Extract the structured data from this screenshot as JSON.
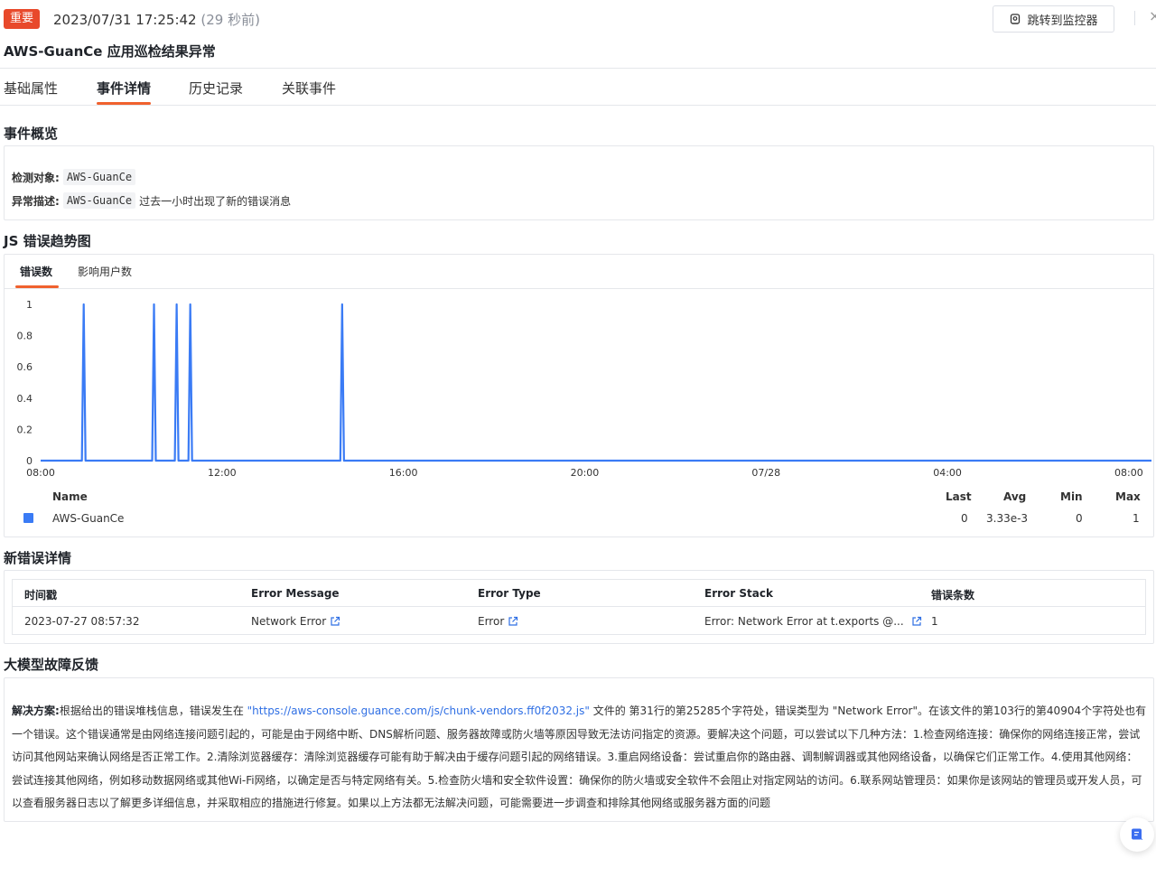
{
  "header": {
    "badge": "重要",
    "timestamp": "2023/07/31 17:25:42",
    "ago": "(29 秒前)",
    "jump_button": "跳转到监控器",
    "close": "×",
    "title": "AWS-GuanCe 应用巡检结果异常"
  },
  "tabs": [
    "基础属性",
    "事件详情",
    "历史记录",
    "关联事件"
  ],
  "overview": {
    "heading": "事件概览",
    "target_label": "检测对象:",
    "target_value": "AWS-GuanCe",
    "desc_label": "异常描述:",
    "desc_code": "AWS-GuanCe",
    "desc_text": "过去一小时出现了新的错误消息"
  },
  "trend": {
    "heading": "JS 错误趋势图",
    "tabs": [
      "错误数",
      "影响用户数"
    ]
  },
  "chart_data": {
    "type": "line",
    "x_ticks": [
      "08:00",
      "12:00",
      "16:00",
      "20:00",
      "07/28",
      "04:00",
      "08:00"
    ],
    "y_ticks": [
      "0",
      "0.2",
      "0.4",
      "0.6",
      "0.8",
      "1"
    ],
    "ylim": [
      0,
      1
    ],
    "xlim_hours": [
      0,
      24.5
    ],
    "color": "#3a7bf5",
    "series": [
      {
        "name": "AWS-GuanCe",
        "spikes_hours": [
          0.95,
          2.5,
          3.0,
          3.3,
          6.65
        ],
        "baseline": 0,
        "peak": 1
      }
    ],
    "legend": {
      "headers": [
        "Name",
        "Last",
        "Avg",
        "Min",
        "Max"
      ],
      "rows": [
        {
          "name": "AWS-GuanCe",
          "last": "0",
          "avg": "3.33e-3",
          "min": "0",
          "max": "1"
        }
      ]
    }
  },
  "new_errors": {
    "heading": "新错误详情",
    "columns": [
      "时间戳",
      "Error Message",
      "Error Type",
      "Error Stack",
      "错误条数"
    ],
    "row": {
      "time": "2023-07-27 08:57:32",
      "message": "Network Error",
      "type": "Error",
      "stack": "Error: Network Error at t.exports @...",
      "count": "1"
    }
  },
  "feedback": {
    "heading": "大模型故障反馈",
    "label": "解决方案:",
    "text_before": "根据给出的错误堆栈信息，错误发生在",
    "url": "\"https://aws-console.guance.com/js/chunk-vendors.ff0f2032.js\"",
    "text_after": "文件的 第31行的第25285个字符处，错误类型为 \"Network Error\"。在该文件的第103行的第40904个字符处也有一个错误。这个错误通常是由网络连接问题引起的，可能是由于网络中断、DNS解析问题、服务器故障或防火墙等原因导致无法访问指定的资源。要解决这个问题，可以尝试以下几种方法：1.检查网络连接：确保你的网络连接正常，尝试访问其他网站来确认网络是否正常工作。2.清除浏览器缓存：清除浏览器缓存可能有助于解决由于缓存问题引起的网络错误。3.重启网络设备：尝试重启你的路由器、调制解调器或其他网络设备，以确保它们正常工作。4.使用其他网络：尝试连接其他网络，例如移动数据网络或其他Wi-Fi网络，以确定是否与特定网络有关。5.检查防火墙和安全软件设置：确保你的防火墙或安全软件不会阻止对指定网站的访问。6.联系网站管理员：如果你是该网站的管理员或开发人员，可以查看服务器日志以了解更多详细信息，并采取相应的措施进行修复。如果以上方法都无法解决问题，可能需要进一步调查和排除其他网络或服务器方面的问题"
  }
}
